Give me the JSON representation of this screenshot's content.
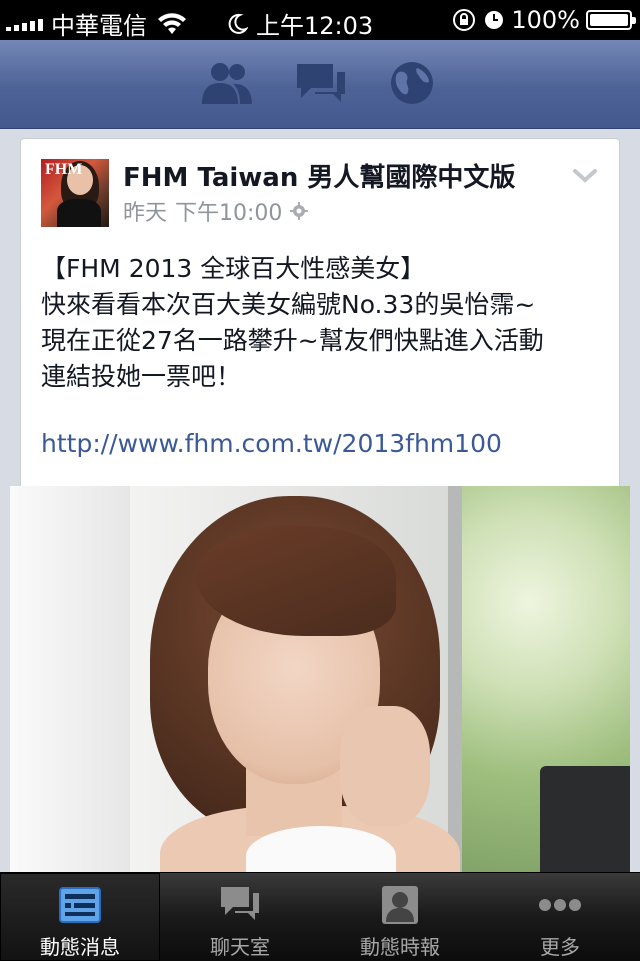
{
  "status_bar": {
    "carrier": "中華電信",
    "time": "上午12:03",
    "battery": "100%",
    "battery_level": 1.0
  },
  "nav_bar": {
    "icons": [
      "friend-requests-icon",
      "messages-icon",
      "notifications-globe-icon"
    ]
  },
  "post": {
    "page_name": "FHM Taiwan 男人幫國際中文版",
    "date": "昨天",
    "time": "下午10:00",
    "text_lines": [
      "【FHM 2013 全球百大性感美女】",
      "快來看看本次百大美女編號No.33的吳怡霈~",
      "現在正從27名一路攀升~幫友們快點進入活動",
      "連結投她一票吧！"
    ],
    "link": "http://www.fhm.com.tw/2013fhm100",
    "avatar_logo": "FHM"
  },
  "tab_bar": {
    "tabs": [
      {
        "label": "動態消息",
        "icon": "news-feed-icon",
        "active": true
      },
      {
        "label": "聊天室",
        "icon": "chat-icon",
        "active": false
      },
      {
        "label": "動態時報",
        "icon": "timeline-icon",
        "active": false
      },
      {
        "label": "更多",
        "icon": "more-icon",
        "active": false
      }
    ]
  },
  "colors": {
    "nav_blue": "#4d6296",
    "link_blue": "#3b5998",
    "text": "#141823",
    "meta_gray": "#90949c"
  }
}
